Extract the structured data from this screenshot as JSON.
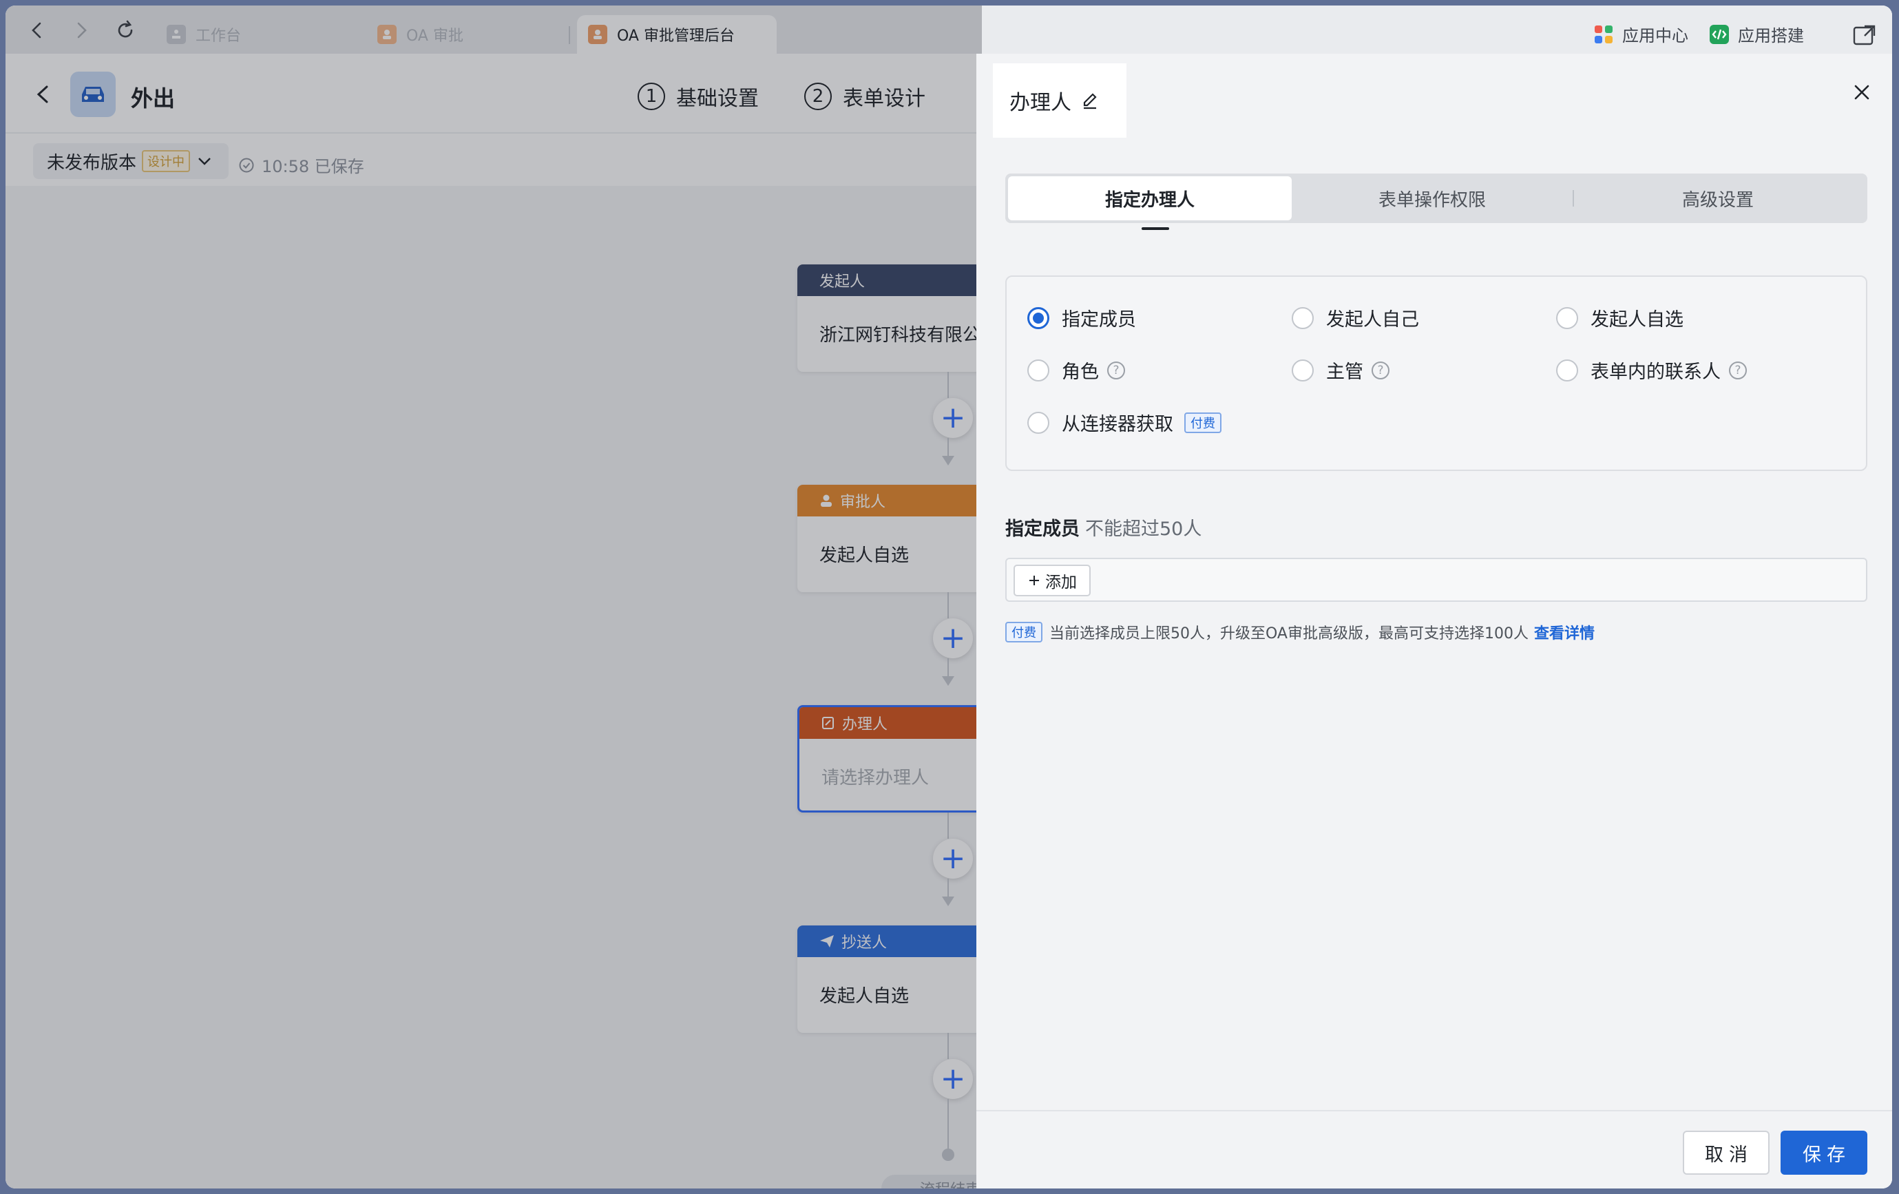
{
  "browser": {
    "tabs": [
      {
        "label": "工作台",
        "active": false
      },
      {
        "label": "OA 审批",
        "active": false
      },
      {
        "label": "OA 审批管理后台",
        "active": true
      }
    ],
    "right_links": {
      "app_center": "应用中心",
      "app_build": "应用搭建"
    }
  },
  "app": {
    "title": "外出",
    "steps": [
      {
        "num": "1",
        "label": "基础设置"
      },
      {
        "num": "2",
        "label": "表单设计"
      }
    ],
    "version_label": "未发布版本",
    "version_tag": "设计中",
    "saved_status": "10:58 已保存"
  },
  "flow": {
    "nodes": [
      {
        "type": "发起人",
        "body": "浙江网钉科技有限公",
        "color": "#3a4768"
      },
      {
        "type": "审批人",
        "body": "发起人自选",
        "color": "#e68a2e"
      },
      {
        "type": "办理人",
        "body": "请选择办理人",
        "color": "#d4561f"
      },
      {
        "type": "抄送人",
        "body": "发起人自选",
        "color": "#2f6fdc"
      }
    ],
    "end_label": "流程结束"
  },
  "drawer": {
    "title": "办理人",
    "tabs": [
      "指定办理人",
      "表单操作权限",
      "高级设置"
    ],
    "options": [
      {
        "label": "指定成员",
        "checked": true
      },
      {
        "label": "发起人自己",
        "checked": false
      },
      {
        "label": "发起人自选",
        "checked": false
      },
      {
        "label": "角色",
        "checked": false,
        "help": true
      },
      {
        "label": "主管",
        "checked": false,
        "help": true
      },
      {
        "label": "表单内的联系人",
        "checked": false,
        "help": true
      },
      {
        "label": "从连接器获取",
        "checked": false,
        "paid": true
      }
    ],
    "paid_tag": "付费",
    "members_label": "指定成员",
    "members_limit": "不能超过50人",
    "add_label": "添加",
    "paid_note": "当前选择成员上限50人，升级至OA审批高级版，最高可支持选择100人",
    "detail_link": "查看详情",
    "cancel_label": "取消",
    "save_label": "保存"
  },
  "colors": {
    "accent": "#1f66d6",
    "drawer_bg": "#f2f3f5"
  }
}
